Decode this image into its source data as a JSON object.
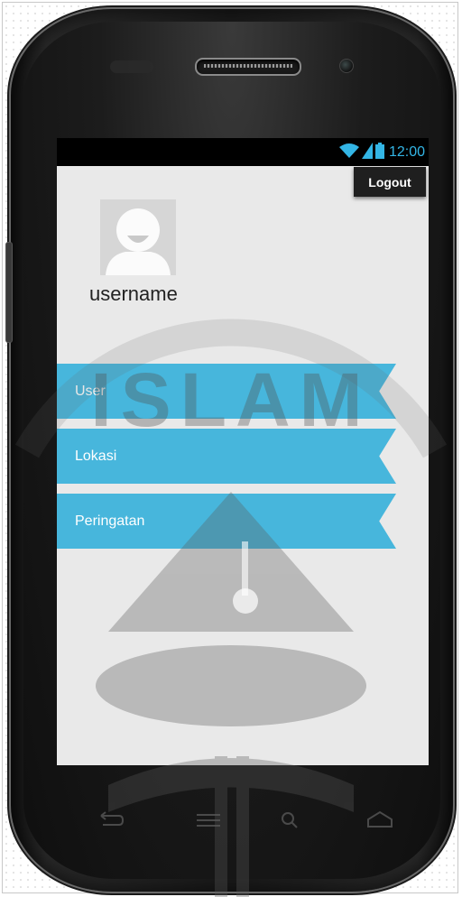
{
  "status_bar": {
    "time": "12:00",
    "icons": [
      "wifi-icon",
      "signal-icon",
      "battery-icon"
    ],
    "accent_color": "#33b5e5"
  },
  "header": {
    "logout_label": "Logout"
  },
  "profile": {
    "username": "username",
    "avatar_icon": "default-avatar-icon"
  },
  "menu": {
    "items": [
      {
        "label": "User"
      },
      {
        "label": "Lokasi"
      },
      {
        "label": "Peringatan"
      }
    ],
    "color": "#47b6dc"
  },
  "watermark": {
    "text": "ISLAM"
  },
  "nav_buttons": [
    "back-icon",
    "menu-icon",
    "search-icon",
    "home-icon"
  ]
}
